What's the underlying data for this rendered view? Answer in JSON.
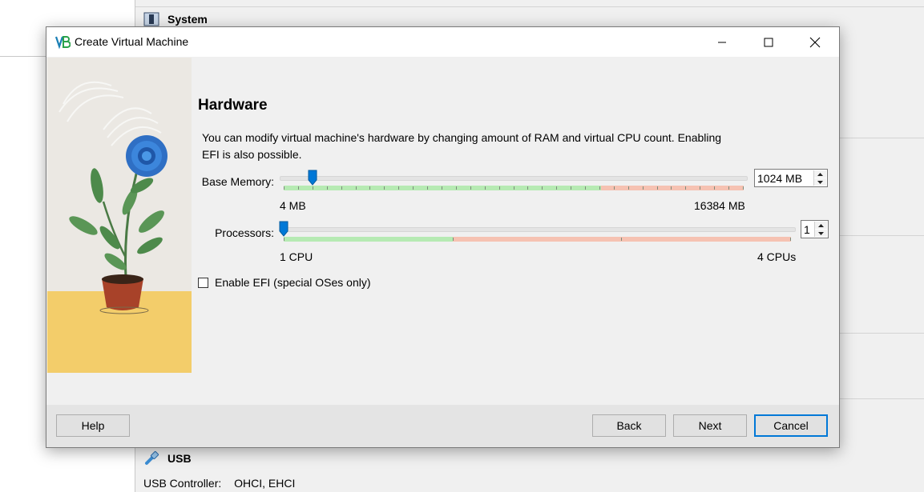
{
  "background": {
    "system_section": "System",
    "usb_section": "USB",
    "usb_controller_label": "USB Controller:",
    "usb_controller_value": "OHCI, EHCI"
  },
  "dialog": {
    "title": "Create Virtual Machine",
    "icons": {
      "app": "virtualbox-logo-icon",
      "minimize": "minimize-icon",
      "maximize": "maximize-icon",
      "close": "close-icon"
    },
    "heading": "Hardware",
    "description_line1": "You can modify virtual machine's hardware by changing amount of RAM and virtual CPU count. Enabling",
    "description_line2": "EFI is also possible.",
    "base_memory": {
      "label": "Base Memory:",
      "value_text": "1024 MB",
      "value_mb": 1024,
      "min": 4,
      "max": 16384,
      "min_label": "4 MB",
      "max_label": "16384 MB",
      "recommended_fraction": 0.69
    },
    "processors": {
      "label": "Processors:",
      "value_text": "1",
      "value": 1,
      "min": 1,
      "max": 4,
      "min_label": "1 CPU",
      "max_label": "4 CPUs",
      "recommended_fraction": 0.333
    },
    "efi": {
      "label": "Enable EFI (special OSes only)",
      "checked": false
    },
    "buttons": {
      "help": "Help",
      "back": "Back",
      "next": "Next",
      "cancel": "Cancel"
    }
  },
  "colors": {
    "accent": "#0078d7",
    "scale_ok": "#b6eab3",
    "scale_warn": "#f6c2b2",
    "side_floor": "#f3cd6a"
  }
}
